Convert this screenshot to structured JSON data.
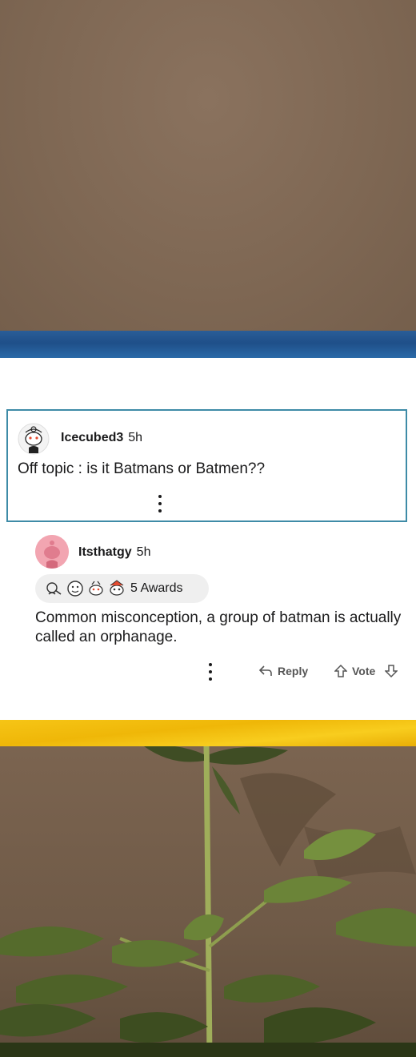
{
  "comments": [
    {
      "username": "Icecubed3",
      "time": "5h",
      "body": "Off topic : is it Batmans or Batmen??"
    },
    {
      "username": "Itsthatgy",
      "time": "5h",
      "awards_label": "5 Awards",
      "body": "Common misconception, a group of batman is actually called an orphanage.",
      "actions": {
        "reply_label": "Reply",
        "vote_label": "Vote"
      }
    }
  ],
  "colors": {
    "blue_band": "#1f4f89",
    "yellow_band": "#efb708",
    "highlight_border": "#3e8ba7",
    "avatar_pink": "#f2a5b1",
    "background_brown": "#7d6652"
  },
  "icons": [
    "snoo-avatar-icon",
    "snoo-avatar-pink-icon",
    "award-icons",
    "more-vertical-icon",
    "reply-arrow-icon",
    "upvote-arrow-icon",
    "downvote-arrow-icon"
  ]
}
